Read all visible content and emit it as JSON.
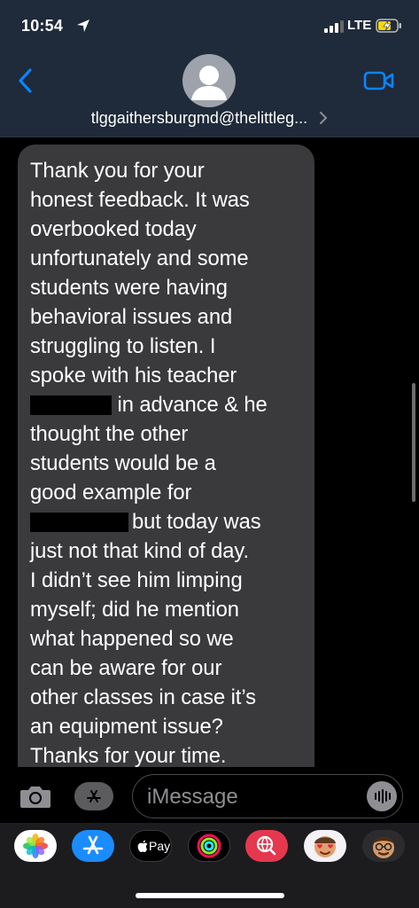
{
  "status_bar": {
    "time": "10:54",
    "network": "LTE"
  },
  "header": {
    "contact": "tlggaithersburgmd@thelittleg...",
    "back_icon": "chevron-left-icon",
    "video_icon": "video-camera-icon"
  },
  "message": {
    "lines": [
      "Thank you for your",
      "honest feedback. It was",
      "overbooked today",
      "unfortunately and some",
      "students were having",
      "behavioral issues and",
      "struggling to listen. I",
      "spoke with his teacher",
      " in advance & he",
      "thought the other",
      "students would be a",
      "good example for",
      "but today was",
      "just not that kind of day.",
      "I didn’t see him limping",
      "myself; did he mention",
      "what happened so we",
      "can be aware for our",
      "other classes in case it’s",
      "an equipment issue?",
      "Thanks for your time."
    ]
  },
  "compose": {
    "placeholder": "iMessage"
  },
  "app_strip": {
    "apple_pay_label": "Pay"
  },
  "colors": {
    "header_bg": "#1f2a3a",
    "accent": "#0a84ff",
    "bubble": "#3a3a3c"
  }
}
